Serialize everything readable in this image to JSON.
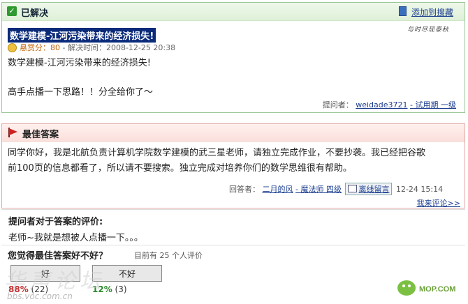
{
  "question": {
    "status": "已解决",
    "favorite_link": "添加到搜藏",
    "slogan": "与时尽现泰秋",
    "title": "数学建模-江河污染带来的经济损失!",
    "reward_label": "悬赏分：80",
    "solved_time": " - 解决时间：2008-12-25 20:38",
    "body": "数学建模-江河污染带来的经济损失!\n\n高手点播一下思路！！分全给你了～",
    "asker_label": "提问者：",
    "asker_name": "weidade3721",
    "asker_level": " - 试用期  一级"
  },
  "best_answer": {
    "title": "最佳答案",
    "body": "同学你好，我是北航负责计算机学院数学建模的武三星老师，请独立完成作业，不要抄袭。我已经把谷歌前100页的信息都看了，所以请不要搜索。独立完成对培养你们的数学思维很有帮助。",
    "answerer_label": "回答者：",
    "answerer_name": "二月的风",
    "answerer_level": " - 魔法师  四级",
    "message_button": "离线留言",
    "time": "12-24 15:14",
    "more_comments": "我来评论>>"
  },
  "evaluation": {
    "title": "提问者对于答案的评价:",
    "text": "老师~我就是想被人点播一下。。。"
  },
  "vote": {
    "question": "您觉得最佳答案好不好？",
    "count_text": "目前有  25 个人评价",
    "good_label": "好",
    "bad_label": "不好",
    "good_pct": "88%",
    "good_count": " (22)",
    "bad_pct": "12%",
    "bad_count": " (3)"
  },
  "watermark": {
    "text": "华声论坛",
    "url": "bbs.voc.com.cn",
    "logo_text": "MOP.COM"
  },
  "colors": {
    "solved_border": "#9cc79a",
    "answer_border": "#e2a8a0",
    "link": "#1a3d8f",
    "title_highlight": "#0a2a7a"
  },
  "icons": [
    "check-icon",
    "bookmark-icon",
    "coin-icon",
    "flag-icon",
    "mail-icon",
    "logo-icon"
  ]
}
